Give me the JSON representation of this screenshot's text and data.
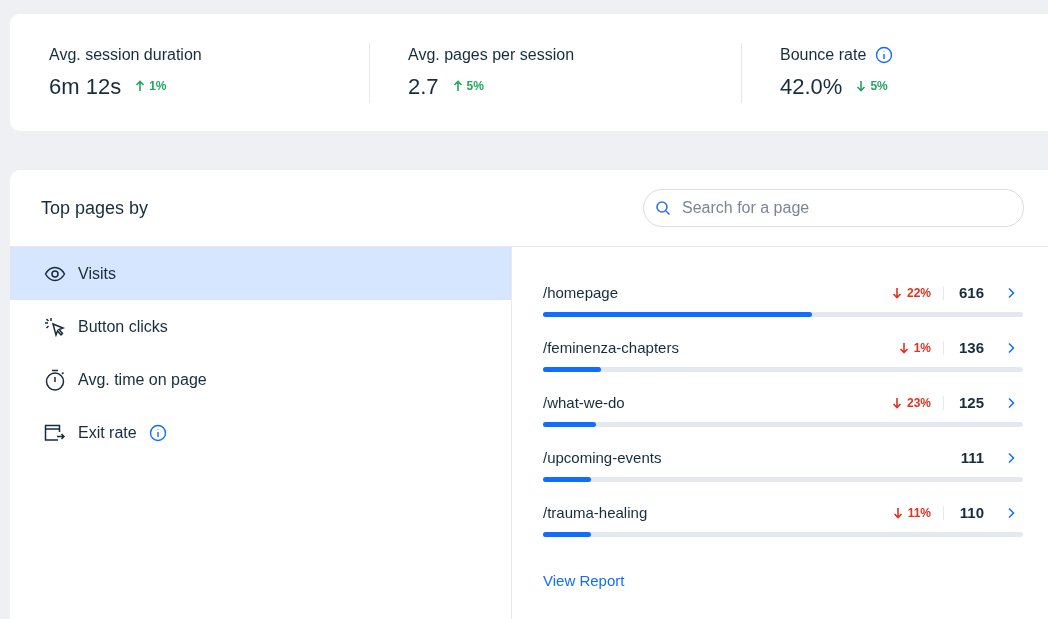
{
  "metrics": [
    {
      "label": "Avg. session duration",
      "value": "6m 12s",
      "trend": {
        "rising": true,
        "text": "1%"
      },
      "info": false
    },
    {
      "label": "Avg. pages per session",
      "value": "2.7",
      "trend": {
        "rising": true,
        "text": "5%"
      },
      "info": false
    },
    {
      "label": "Bounce rate",
      "value": "42.0%",
      "trend": {
        "rising": false,
        "text": "5%"
      },
      "info": true
    }
  ],
  "top_pages": {
    "title": "Top pages by",
    "search": {
      "placeholder": "Search for a page"
    },
    "sidebar": {
      "items": [
        {
          "label": "Visits",
          "selected": true,
          "info": false
        },
        {
          "label": "Button clicks",
          "selected": false,
          "info": false
        },
        {
          "label": "Avg. time on page",
          "selected": false,
          "info": false
        },
        {
          "label": "Exit rate",
          "selected": false,
          "info": true
        }
      ]
    },
    "pages": [
      {
        "path": "/homepage",
        "change": "22%",
        "count": "616",
        "level": 0.56
      },
      {
        "path": "/feminenza-chapters",
        "change": "1%",
        "count": "136",
        "level": 0.12
      },
      {
        "path": "/what-we-do",
        "change": "23%",
        "count": "125",
        "level": 0.11
      },
      {
        "path": "/upcoming-events",
        "count": "111",
        "level": 0.1
      },
      {
        "path": "/trauma-healing",
        "change": "11%",
        "count": "110",
        "level": 0.1
      }
    ],
    "link": "View Report"
  }
}
